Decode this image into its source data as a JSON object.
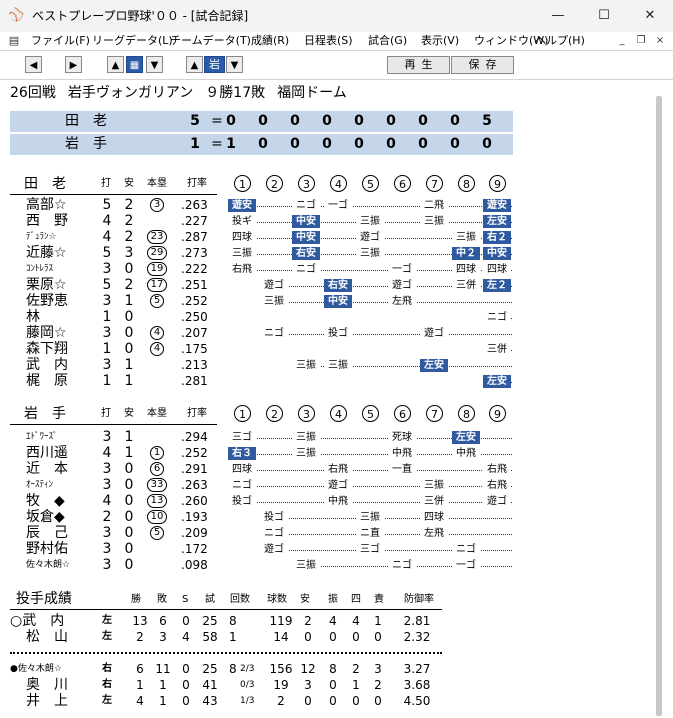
{
  "window": {
    "title": "ベストプレープロ野球'００ - [試合記録]",
    "minimize": "—",
    "maximize": "☐",
    "close": "✕"
  },
  "menu": [
    "ファイル(F)",
    "リーグデータ(L)",
    "チームデータ(T)",
    "成績(R)",
    "日程表(S)",
    "試合(G)",
    "表示(V)",
    "ウィンドウ(W)",
    "ヘルプ(H)"
  ],
  "toolbar": {
    "team_label": "岩",
    "play_label": "再生",
    "save_label": "保存"
  },
  "game": {
    "round": "26回戦",
    "team": "岩手ヴォンガリアン",
    "record": "９勝17敗",
    "stadium": "福岡ドーム"
  },
  "linescore": [
    {
      "team": "田老",
      "total": "5",
      "eq": "=",
      "innings": [
        "0",
        "0",
        "0",
        "0",
        "0",
        "0",
        "0",
        "0",
        "5"
      ]
    },
    {
      "team": "岩手",
      "total": "1",
      "eq": "=",
      "innings": [
        "1",
        "0",
        "0",
        "0",
        "0",
        "0",
        "0",
        "0",
        "0"
      ]
    }
  ],
  "columns": {
    "at_bats": "打",
    "hits": "安",
    "hr": "本塁",
    "avg": "打率"
  },
  "inning_labels": [
    "1",
    "2",
    "3",
    "4",
    "5",
    "6",
    "7",
    "8",
    "9"
  ],
  "teamA": {
    "name": "田老",
    "batters": [
      {
        "name": "高部☆",
        "ab": "5",
        "h": "2",
        "hr": "3",
        "avg": ".263"
      },
      {
        "name": "西　野",
        "ab": "4",
        "h": "2",
        "hr": "",
        "avg": ".227"
      },
      {
        "name": "ﾃﾞｭﾗﾝ☆",
        "ab": "4",
        "h": "2",
        "hr": "23",
        "avg": ".287"
      },
      {
        "name": "近藤☆",
        "ab": "5",
        "h": "3",
        "hr": "29",
        "avg": ".273"
      },
      {
        "name": "ｺﾝﾄﾚﾗｽ",
        "ab": "3",
        "h": "0",
        "hr": "19",
        "avg": ".222"
      },
      {
        "name": "栗原☆",
        "ab": "5",
        "h": "2",
        "hr": "17",
        "avg": ".251"
      },
      {
        "name": "佐野恵",
        "ab": "3",
        "h": "1",
        "hr": "5",
        "avg": ".252"
      },
      {
        "name": "林",
        "ab": "1",
        "h": "0",
        "hr": "",
        "avg": ".250"
      },
      {
        "name": "藤岡☆",
        "ab": "3",
        "h": "0",
        "hr": "4",
        "avg": ".207"
      },
      {
        "name": "森下翔",
        "ab": "1",
        "h": "0",
        "hr": "4",
        "avg": ".175"
      },
      {
        "name": "武　内",
        "ab": "3",
        "h": "1",
        "hr": "",
        "avg": ".213"
      },
      {
        "name": "梶　原",
        "ab": "1",
        "h": "1",
        "hr": "",
        "avg": ".281"
      }
    ]
  },
  "teamB": {
    "name": "岩手",
    "batters": [
      {
        "name": "ｴﾄﾞﾜｰｽﾞ",
        "ab": "3",
        "h": "1",
        "hr": "",
        "avg": ".294"
      },
      {
        "name": "西川遥",
        "ab": "4",
        "h": "1",
        "hr": "1",
        "avg": ".252"
      },
      {
        "name": "近　本",
        "ab": "3",
        "h": "0",
        "hr": "6",
        "avg": ".291"
      },
      {
        "name": "ｵｰｽﾃｨﾝ",
        "ab": "3",
        "h": "0",
        "hr": "33",
        "avg": ".263"
      },
      {
        "name": "牧　◆",
        "ab": "4",
        "h": "0",
        "hr": "13",
        "avg": ".260"
      },
      {
        "name": "坂倉◆",
        "ab": "2",
        "h": "0",
        "hr": "10",
        "avg": ".193"
      },
      {
        "name": "辰　己",
        "ab": "3",
        "h": "0",
        "hr": "5",
        "avg": ".209"
      },
      {
        "name": "野村佑",
        "ab": "3",
        "h": "0",
        "hr": "",
        "avg": ".172"
      },
      {
        "name": "佐々木朗☆",
        "ab": "3",
        "h": "0",
        "hr": "",
        "avg": ".098"
      }
    ]
  },
  "pitching": {
    "title": "投手成績",
    "columns": [
      "勝",
      "敗",
      "S",
      "試",
      "回数",
      "球数",
      "安",
      "振",
      "四",
      "責",
      "防御率"
    ],
    "teamA": [
      {
        "mark": "○",
        "name": "武　内",
        "hand": "左",
        "w": "13",
        "l": "6",
        "s": "0",
        "g": "25",
        "ip": "8",
        "ipf": "",
        "np": "119",
        "h": "2",
        "k": "4",
        "bb": "4",
        "er": "1",
        "era": "2.81"
      },
      {
        "mark": "",
        "name": "松　山",
        "hand": "左",
        "w": "2",
        "l": "3",
        "s": "4",
        "g": "58",
        "ip": "1",
        "ipf": "",
        "np": "14",
        "h": "0",
        "k": "0",
        "bb": "0",
        "er": "0",
        "era": "2.32"
      }
    ],
    "teamB": [
      {
        "mark": "●",
        "name": "佐々木朗☆",
        "hand": "右",
        "w": "6",
        "l": "11",
        "s": "0",
        "g": "25",
        "ip": "8",
        "ipf": "2/3",
        "np": "156",
        "h": "12",
        "k": "8",
        "bb": "2",
        "er": "3",
        "era": "3.27"
      },
      {
        "mark": "",
        "name": "奥　川",
        "hand": "右",
        "w": "1",
        "l": "1",
        "s": "0",
        "g": "41",
        "ip": "",
        "ipf": "0/3",
        "np": "19",
        "h": "3",
        "k": "0",
        "bb": "1",
        "er": "2",
        "era": "3.68"
      },
      {
        "mark": "",
        "name": "井　上",
        "hand": "左",
        "w": "4",
        "l": "1",
        "s": "0",
        "g": "43",
        "ip": "",
        "ipf": "1/3",
        "np": "2",
        "h": "0",
        "k": "0",
        "bb": "0",
        "er": "0",
        "era": "4.50"
      }
    ]
  },
  "pbpA": [
    [
      {
        "i": 1,
        "t": "遊安",
        "hl": true
      },
      {
        "i": 3,
        "t": "ニゴ"
      },
      {
        "i": 4,
        "t": "一ゴ"
      },
      {
        "i": 7,
        "t": "二飛"
      },
      {
        "i": 9,
        "t": "遊安",
        "hl": true
      }
    ],
    [
      {
        "i": 1,
        "t": "投ギ"
      },
      {
        "i": 3,
        "t": "中安",
        "hl": true
      },
      {
        "i": 5,
        "t": "三振"
      },
      {
        "i": 7,
        "t": "三振"
      },
      {
        "i": 9,
        "t": "左安",
        "hl": true
      }
    ],
    [
      {
        "i": 1,
        "t": "四球"
      },
      {
        "i": 3,
        "t": "中安",
        "hl": true
      },
      {
        "i": 5,
        "t": "遊ゴ"
      },
      {
        "i": 8,
        "t": "三振"
      },
      {
        "i": 9,
        "t": "右２",
        "hl": true
      }
    ],
    [
      {
        "i": 1,
        "t": "三振"
      },
      {
        "i": 3,
        "t": "右安",
        "hl": true
      },
      {
        "i": 5,
        "t": "三振"
      },
      {
        "i": 8,
        "t": "中２",
        "hl": true
      },
      {
        "i": 9,
        "t": "中安",
        "hl": true
      }
    ],
    [
      {
        "i": 1,
        "t": "右飛"
      },
      {
        "i": 3,
        "t": "ニゴ"
      },
      {
        "i": 6,
        "t": "一ゴ"
      },
      {
        "i": 8,
        "t": "四球"
      },
      {
        "i": 9,
        "t": "四球"
      }
    ],
    [
      {
        "i": 2,
        "t": "遊ゴ"
      },
      {
        "i": 4,
        "t": "右安",
        "hl": true
      },
      {
        "i": 6,
        "t": "遊ゴ"
      },
      {
        "i": 8,
        "t": "三併"
      },
      {
        "i": 9,
        "t": "左２",
        "hl": true
      }
    ],
    [
      {
        "i": 2,
        "t": "三振"
      },
      {
        "i": 4,
        "t": "中安",
        "hl": true
      },
      {
        "i": 6,
        "t": "左飛"
      }
    ],
    [
      {
        "i": 9,
        "t": "ニゴ"
      }
    ],
    [
      {
        "i": 2,
        "t": "ニゴ"
      },
      {
        "i": 4,
        "t": "投ゴ"
      },
      {
        "i": 7,
        "t": "遊ゴ"
      }
    ],
    [
      {
        "i": 9,
        "t": "三併"
      }
    ],
    [
      {
        "i": 3,
        "t": "三振"
      },
      {
        "i": 4,
        "t": "三振"
      },
      {
        "i": 7,
        "t": "左安",
        "hl": true
      }
    ],
    [
      {
        "i": 9,
        "t": "左安",
        "hl": true
      }
    ]
  ],
  "pbpB": [
    [
      {
        "i": 1,
        "t": "三ゴ"
      },
      {
        "i": 3,
        "t": "三振"
      },
      {
        "i": 6,
        "t": "死球"
      },
      {
        "i": 8,
        "t": "左安",
        "hl": true
      }
    ],
    [
      {
        "i": 1,
        "t": "右３",
        "hl": true
      },
      {
        "i": 3,
        "t": "三振"
      },
      {
        "i": 6,
        "t": "中飛"
      },
      {
        "i": 8,
        "t": "中飛"
      }
    ],
    [
      {
        "i": 1,
        "t": "四球"
      },
      {
        "i": 4,
        "t": "右飛"
      },
      {
        "i": 6,
        "t": "一直"
      },
      {
        "i": 9,
        "t": "右飛"
      }
    ],
    [
      {
        "i": 1,
        "t": "ニゴ"
      },
      {
        "i": 4,
        "t": "遊ゴ"
      },
      {
        "i": 7,
        "t": "三振"
      },
      {
        "i": 9,
        "t": "右飛"
      }
    ],
    [
      {
        "i": 1,
        "t": "投ゴ"
      },
      {
        "i": 4,
        "t": "中飛"
      },
      {
        "i": 7,
        "t": "三併"
      },
      {
        "i": 9,
        "t": "遊ゴ"
      }
    ],
    [
      {
        "i": 2,
        "t": "投ゴ"
      },
      {
        "i": 5,
        "t": "三振"
      },
      {
        "i": 7,
        "t": "四球"
      }
    ],
    [
      {
        "i": 2,
        "t": "ニゴ"
      },
      {
        "i": 5,
        "t": "ニ直"
      },
      {
        "i": 7,
        "t": "左飛"
      }
    ],
    [
      {
        "i": 2,
        "t": "遊ゴ"
      },
      {
        "i": 5,
        "t": "三ゴ"
      },
      {
        "i": 8,
        "t": "ニゴ"
      }
    ],
    [
      {
        "i": 3,
        "t": "三振"
      },
      {
        "i": 6,
        "t": "ニゴ"
      },
      {
        "i": 8,
        "t": "一ゴ"
      }
    ]
  ]
}
